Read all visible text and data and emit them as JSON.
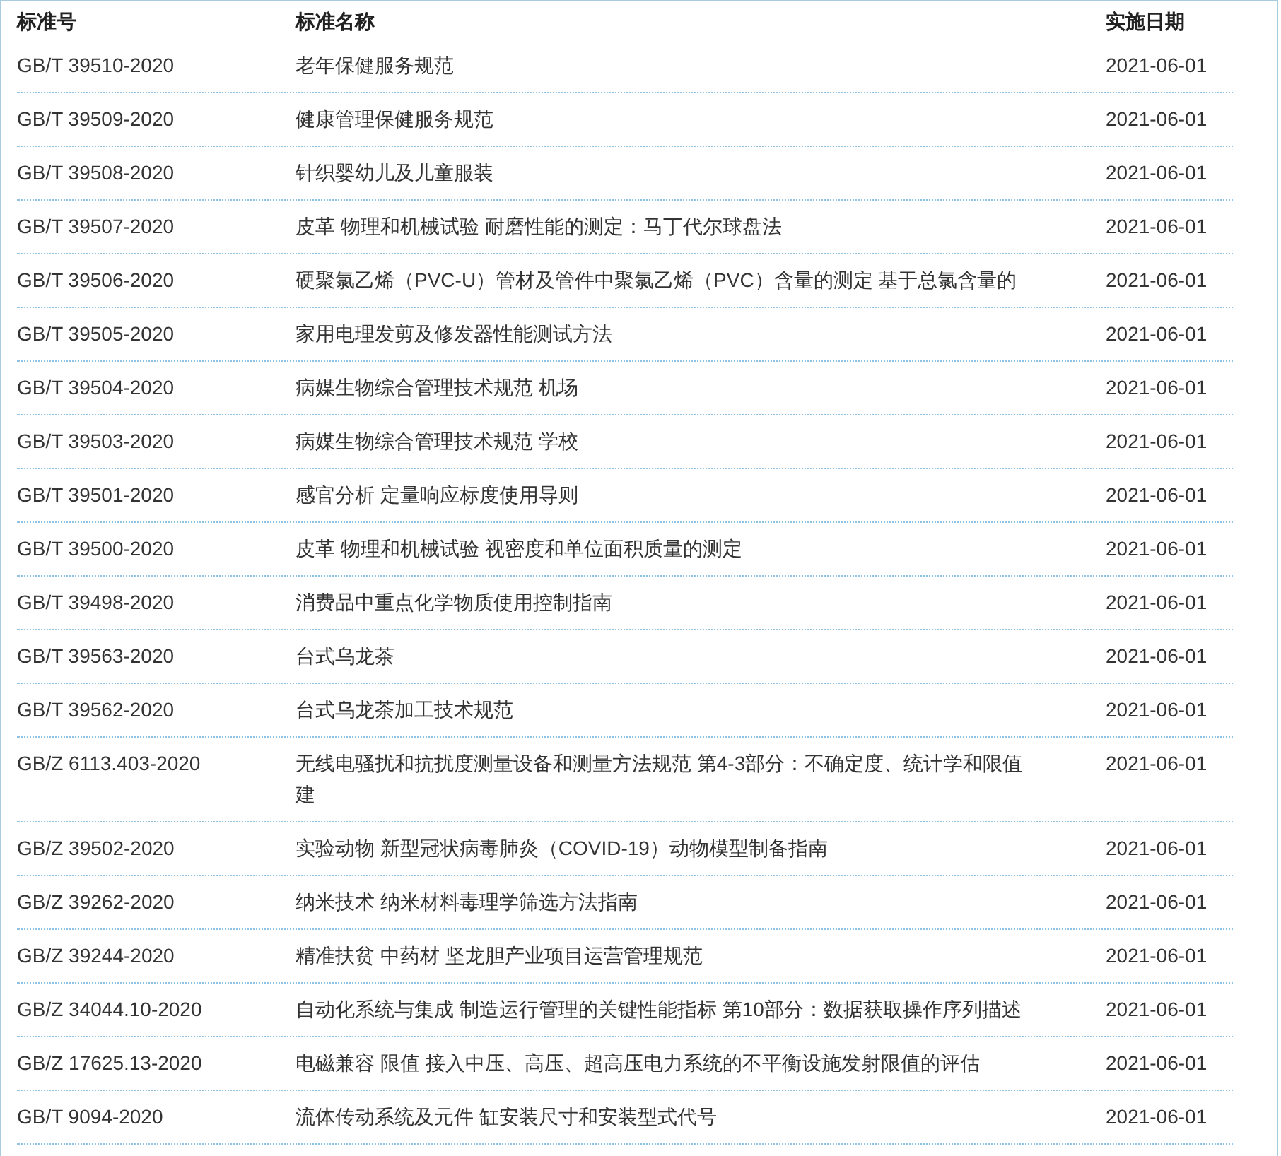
{
  "table": {
    "columns": [
      "标准号",
      "标准名称",
      "实施日期"
    ],
    "rows": [
      [
        "GB/T 39510-2020",
        "老年保健服务规范",
        "2021-06-01"
      ],
      [
        "GB/T 39509-2020",
        "健康管理保健服务规范",
        "2021-06-01"
      ],
      [
        "GB/T 39508-2020",
        "针织婴幼儿及儿童服装",
        "2021-06-01"
      ],
      [
        "GB/T 39507-2020",
        "皮革 物理和机械试验 耐磨性能的测定：马丁代尔球盘法",
        "2021-06-01"
      ],
      [
        "GB/T 39506-2020",
        "硬聚氯乙烯（PVC-U）管材及管件中聚氯乙烯（PVC）含量的测定 基于总氯含量的",
        "2021-06-01"
      ],
      [
        "GB/T 39505-2020",
        "家用电理发剪及修发器性能测试方法",
        "2021-06-01"
      ],
      [
        "GB/T 39504-2020",
        "病媒生物综合管理技术规范 机场",
        "2021-06-01"
      ],
      [
        "GB/T 39503-2020",
        "病媒生物综合管理技术规范 学校",
        "2021-06-01"
      ],
      [
        "GB/T 39501-2020",
        "感官分析 定量响应标度使用导则",
        "2021-06-01"
      ],
      [
        "GB/T 39500-2020",
        "皮革 物理和机械试验 视密度和单位面积质量的测定",
        "2021-06-01"
      ],
      [
        "GB/T 39498-2020",
        "消费品中重点化学物质使用控制指南",
        "2021-06-01"
      ],
      [
        "GB/T 39563-2020",
        "台式乌龙茶",
        "2021-06-01"
      ],
      [
        "GB/T 39562-2020",
        "台式乌龙茶加工技术规范",
        "2021-06-01"
      ],
      [
        "GB/Z 6113.403-2020",
        "无线电骚扰和抗扰度测量设备和测量方法规范 第4-3部分：不确定度、统计学和限值建",
        "2021-06-01"
      ],
      [
        "GB/Z 39502-2020",
        "实验动物 新型冠状病毒肺炎（COVID-19）动物模型制备指南",
        "2021-06-01"
      ],
      [
        "GB/Z 39262-2020",
        "纳米技术 纳米材料毒理学筛选方法指南",
        "2021-06-01"
      ],
      [
        "GB/Z 39244-2020",
        "精准扶贫 中药材 坚龙胆产业项目运营管理规范",
        "2021-06-01"
      ],
      [
        "GB/Z 34044.10-2020",
        "自动化系统与集成 制造运行管理的关键性能指标 第10部分：数据获取操作序列描述",
        "2021-06-01"
      ],
      [
        "GB/Z 17625.13-2020",
        "电磁兼容 限值 接入中压、高压、超高压电力系统的不平衡设施发射限值的评估",
        "2021-06-01"
      ],
      [
        "GB/T 9094-2020",
        "流体传动系统及元件 缸安装尺寸和安装型式代号",
        "2021-06-01"
      ]
    ]
  }
}
